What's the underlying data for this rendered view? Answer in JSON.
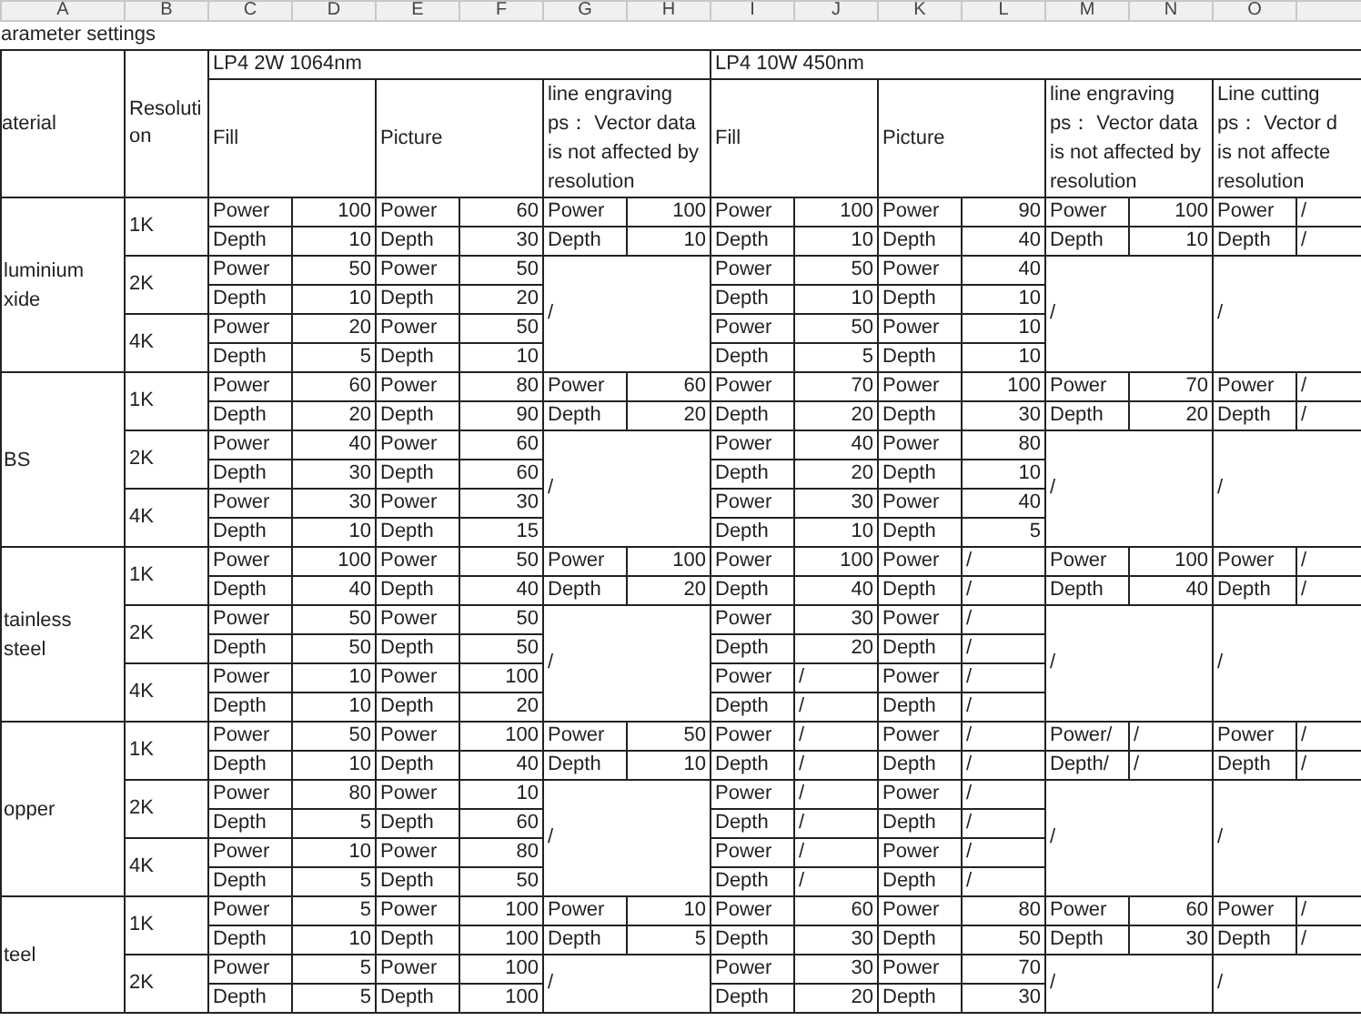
{
  "column_headers": [
    "A",
    "B",
    "C",
    "D",
    "E",
    "F",
    "G",
    "H",
    "I",
    "J",
    "K",
    "L",
    "M",
    "N",
    "O"
  ],
  "title": "arameter settings",
  "header": {
    "material": "aterial",
    "resolution": "Resolution",
    "lasers": [
      {
        "name": "LP4 2W 1064nm"
      },
      {
        "name": "LP4 10W 450nm"
      }
    ],
    "modes": [
      {
        "lines": [
          "Fill"
        ]
      },
      {
        "lines": [
          "Picture"
        ]
      },
      {
        "lines": [
          "line engraving",
          "ps：  Vector data",
          "is not affected by",
          "resolution"
        ]
      },
      {
        "lines": [
          "Fill"
        ]
      },
      {
        "lines": [
          "Picture"
        ]
      },
      {
        "lines": [
          "line engraving",
          "ps：  Vector data",
          "is not affected by",
          "resolution"
        ]
      },
      {
        "lines": [
          "Line cutting",
          "ps：  Vector d",
          "is not affecte",
          "resolution"
        ]
      }
    ]
  },
  "materials": [
    {
      "name": "luminium xide",
      "merged": [
        "/",
        "/",
        "/"
      ],
      "groups": [
        {
          "resolution": "1K",
          "rows": [
            [
              "Power",
              "100",
              "Power",
              "60",
              "Power",
              "100",
              "Power",
              "100",
              "Power",
              "90",
              "Power",
              "100",
              "Power",
              "/"
            ],
            [
              "Depth",
              "10",
              "Depth",
              "30",
              "Depth",
              "10",
              "Depth",
              "10",
              "Depth",
              "40",
              "Depth",
              "10",
              "Depth",
              "/"
            ]
          ]
        },
        {
          "resolution": "2K",
          "rows": [
            [
              "Power",
              "50",
              "Power",
              "50",
              "Power",
              "50",
              "Power",
              "40"
            ],
            [
              "Depth",
              "10",
              "Depth",
              "20",
              "Depth",
              "10",
              "Depth",
              "10"
            ]
          ]
        },
        {
          "resolution": "4K",
          "rows": [
            [
              "Power",
              "20",
              "Power",
              "50",
              "Power",
              "50",
              "Power",
              "10"
            ],
            [
              "Depth",
              "5",
              "Depth",
              "10",
              "Depth",
              "5",
              "Depth",
              "10"
            ]
          ]
        }
      ]
    },
    {
      "name": "BS",
      "merged": [
        "/",
        "/",
        "/"
      ],
      "groups": [
        {
          "resolution": "1K",
          "rows": [
            [
              "Power",
              "60",
              "Power",
              "80",
              "Power",
              "60",
              "Power",
              "70",
              "Power",
              "100",
              "Power",
              "70",
              "Power",
              "/"
            ],
            [
              "Depth",
              "20",
              "Depth",
              "90",
              "Depth",
              "20",
              "Depth",
              "20",
              "Depth",
              "30",
              "Depth",
              "20",
              "Depth",
              "/"
            ]
          ]
        },
        {
          "resolution": "2K",
          "rows": [
            [
              "Power",
              "40",
              "Power",
              "60",
              "Power",
              "40",
              "Power",
              "80"
            ],
            [
              "Depth",
              "30",
              "Depth",
              "60",
              "Depth",
              "20",
              "Depth",
              "10"
            ]
          ]
        },
        {
          "resolution": "4K",
          "rows": [
            [
              "Power",
              "30",
              "Power",
              "30",
              "Power",
              "30",
              "Power",
              "40"
            ],
            [
              "Depth",
              "10",
              "Depth",
              "15",
              "Depth",
              "10",
              "Depth",
              "5"
            ]
          ]
        }
      ]
    },
    {
      "name": "tainless steel",
      "merged": [
        "/",
        "/",
        "/"
      ],
      "groups": [
        {
          "resolution": "1K",
          "rows": [
            [
              "Power",
              "100",
              "Power",
              "50",
              "Power",
              "100",
              "Power",
              "100",
              "Power",
              "/",
              "Power",
              "100",
              "Power",
              "/"
            ],
            [
              "Depth",
              "40",
              "Depth",
              "40",
              "Depth",
              "20",
              "Depth",
              "40",
              "Depth",
              "/",
              "Depth",
              "40",
              "Depth",
              "/"
            ]
          ]
        },
        {
          "resolution": "2K",
          "rows": [
            [
              "Power",
              "50",
              "Power",
              "50",
              "Power",
              "30",
              "Power",
              "/"
            ],
            [
              "Depth",
              "50",
              "Depth",
              "50",
              "Depth",
              "20",
              "Depth",
              "/"
            ]
          ]
        },
        {
          "resolution": "4K",
          "rows": [
            [
              "Power",
              "10",
              "Power",
              "100",
              "Power",
              "/",
              "Power",
              "/"
            ],
            [
              "Depth",
              "10",
              "Depth",
              "20",
              "Depth",
              "/",
              "Depth",
              "/"
            ]
          ]
        }
      ]
    },
    {
      "name": "opper",
      "merged": [
        "/",
        "/",
        "/"
      ],
      "groups": [
        {
          "resolution": "1K",
          "rows": [
            [
              "Power",
              "50",
              "Power",
              "100",
              "Power",
              "50",
              "Power",
              "/",
              "Power",
              "/",
              "Power/",
              "/",
              "Power",
              "/"
            ],
            [
              "Depth",
              "10",
              "Depth",
              "40",
              "Depth",
              "10",
              "Depth",
              "/",
              "Depth",
              "/",
              "Depth/",
              "/",
              "Depth",
              "/"
            ]
          ]
        },
        {
          "resolution": "2K",
          "rows": [
            [
              "Power",
              "80",
              "Power",
              "10",
              "Power",
              "/",
              "Power",
              "/"
            ],
            [
              "Depth",
              "5",
              "Depth",
              "60",
              "Depth",
              "/",
              "Depth",
              "/"
            ]
          ]
        },
        {
          "resolution": "4K",
          "rows": [
            [
              "Power",
              "10",
              "Power",
              "80",
              "Power",
              "/",
              "Power",
              "/"
            ],
            [
              "Depth",
              "5",
              "Depth",
              "50",
              "Depth",
              "/",
              "Depth",
              "/"
            ]
          ]
        }
      ]
    },
    {
      "name": "teel",
      "merged": [
        "/",
        "/",
        "/"
      ],
      "groups": [
        {
          "resolution": "1K",
          "rows": [
            [
              "Power",
              "5",
              "Power",
              "100",
              "Power",
              "10",
              "Power",
              "60",
              "Power",
              "80",
              "Power",
              "60",
              "Power",
              "/"
            ],
            [
              "Depth",
              "10",
              "Depth",
              "100",
              "Depth",
              "5",
              "Depth",
              "30",
              "Depth",
              "50",
              "Depth",
              "30",
              "Depth",
              "/"
            ]
          ]
        },
        {
          "resolution": "2K",
          "rows": [
            [
              "Power",
              "5",
              "Power",
              "100",
              "Power",
              "30",
              "Power",
              "70"
            ],
            [
              "Depth",
              "5",
              "Depth",
              "100",
              "Depth",
              "20",
              "Depth",
              "30"
            ]
          ]
        }
      ]
    }
  ]
}
